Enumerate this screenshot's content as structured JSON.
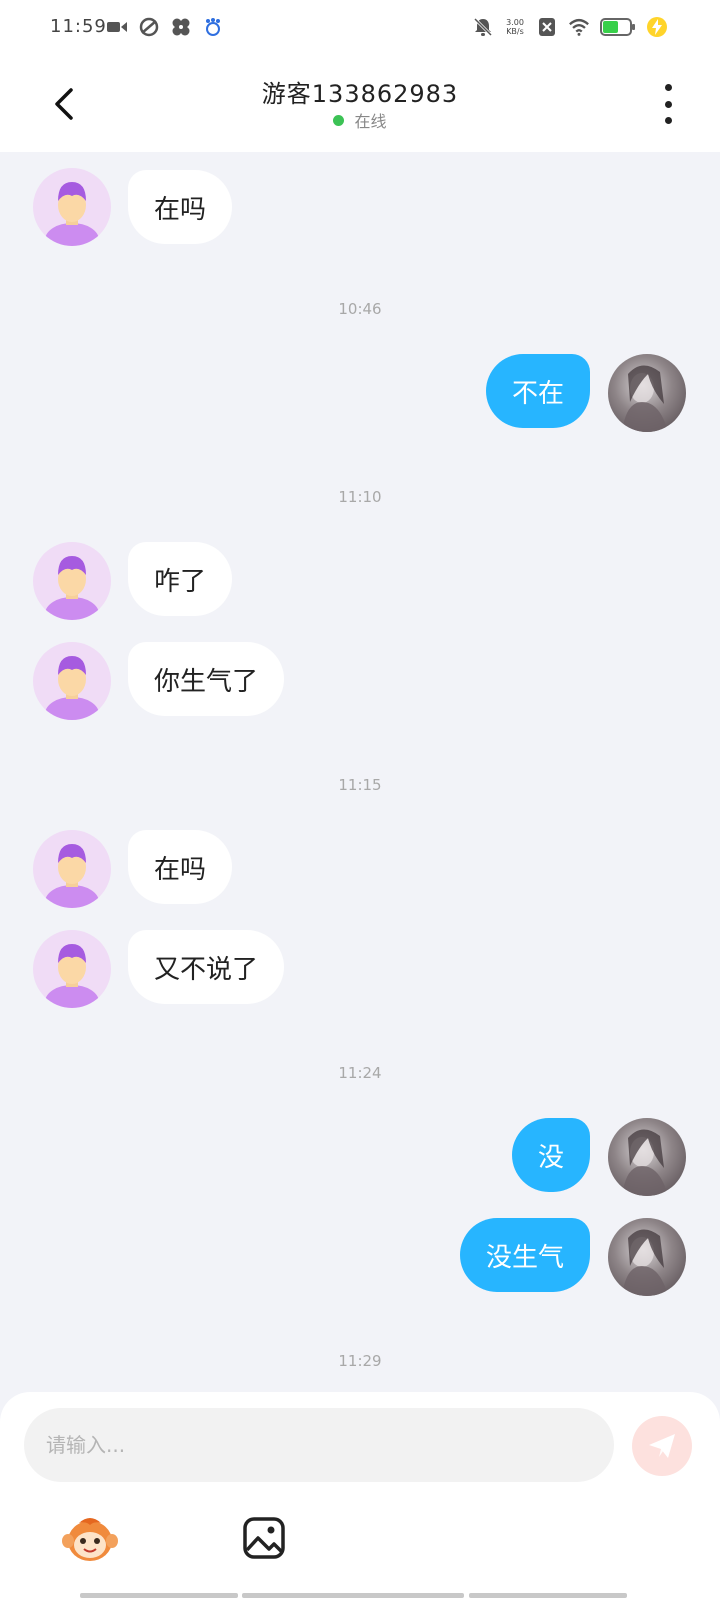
{
  "status_bar": {
    "time": "11:59",
    "net_speed_value": "3.00",
    "net_speed_unit": "KB/s",
    "left_icons": [
      "video-icon",
      "orbit-icon",
      "fan-icon",
      "baidu-icon"
    ],
    "right_icons": [
      "bell-off-icon",
      "sim-off-icon",
      "wifi-icon",
      "battery-icon",
      "charging-icon"
    ]
  },
  "header": {
    "title": "游客133862983",
    "status": "在线"
  },
  "messages": [
    {
      "type": "in",
      "text": "在吗"
    },
    {
      "type": "time",
      "text": "10:46"
    },
    {
      "type": "out",
      "text": "不在"
    },
    {
      "type": "time",
      "text": "11:10"
    },
    {
      "type": "in",
      "text": "咋了"
    },
    {
      "type": "in",
      "text": "你生气了"
    },
    {
      "type": "time",
      "text": "11:15"
    },
    {
      "type": "in",
      "text": "在吗"
    },
    {
      "type": "in",
      "text": "又不说了"
    },
    {
      "type": "time",
      "text": "11:24"
    },
    {
      "type": "out",
      "text": "没"
    },
    {
      "type": "out",
      "text": "没生气"
    },
    {
      "type": "time",
      "text": "11:29"
    }
  ],
  "composer": {
    "placeholder": "请输入...",
    "value": ""
  },
  "colors": {
    "outgoing_bubble": "#27b5ff",
    "incoming_bubble": "#ffffff",
    "background": "#f2f3f8",
    "online_dot": "#3cc255",
    "send_button": "#fde1de"
  }
}
